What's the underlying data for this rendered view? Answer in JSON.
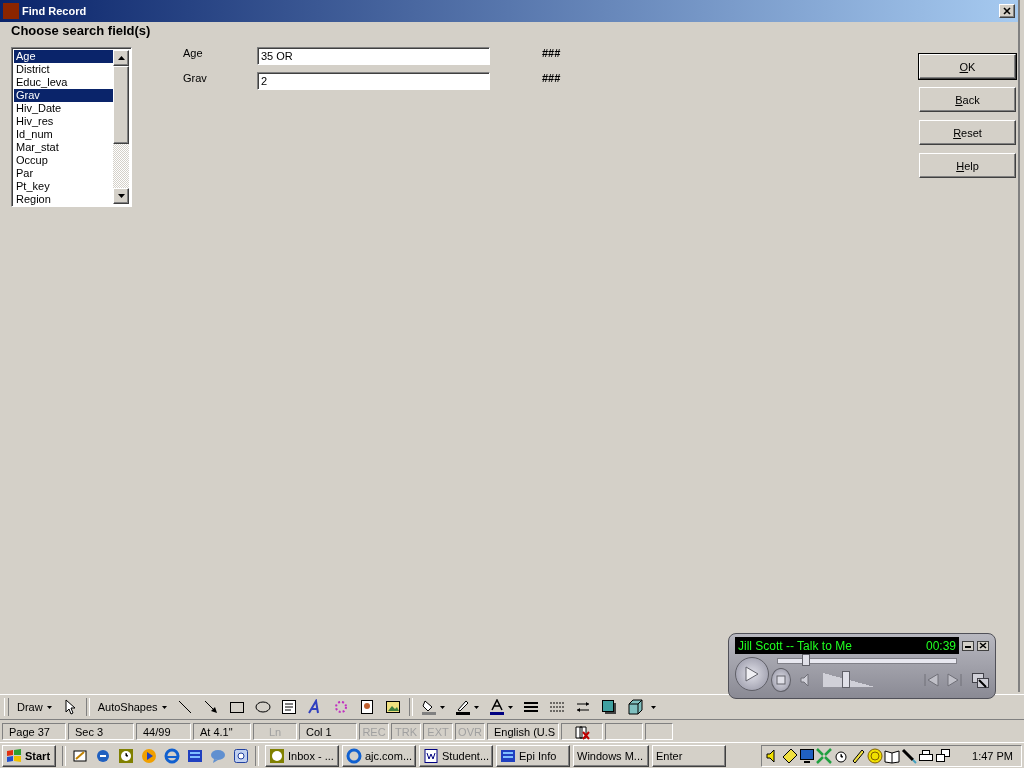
{
  "window": {
    "title": "Find Record",
    "heading": "Choose search field(s)"
  },
  "listbox": {
    "items": [
      {
        "label": "Age",
        "selected": true
      },
      {
        "label": "District",
        "selected": false
      },
      {
        "label": "Educ_leva",
        "selected": false
      },
      {
        "label": "Grav",
        "selected": true
      },
      {
        "label": "Hiv_Date",
        "selected": false
      },
      {
        "label": "Hiv_res",
        "selected": false
      },
      {
        "label": "Id_num",
        "selected": false
      },
      {
        "label": "Mar_stat",
        "selected": false
      },
      {
        "label": "Occup",
        "selected": false
      },
      {
        "label": "Par",
        "selected": false
      },
      {
        "label": "Pt_key",
        "selected": false
      },
      {
        "label": "Region",
        "selected": false
      }
    ]
  },
  "fields": [
    {
      "label": "Age",
      "value": "35 OR",
      "format": "###"
    },
    {
      "label": "Grav",
      "value": "2",
      "format": "###"
    }
  ],
  "buttons": [
    "OK",
    "Back",
    "Reset",
    "Help"
  ],
  "media_player": {
    "track": "Jill Scott -- Talk to Me",
    "time": "00:39",
    "seek": {
      "level": 0.16
    },
    "volume": {
      "level": 0.45
    }
  },
  "drawing_toolbar": {
    "draw_menu": "Draw",
    "autoshapes_menu": "AutoShapes"
  },
  "status_bar": {
    "panes": [
      {
        "text": "Page 37",
        "disabled": false
      },
      {
        "text": "Sec 3",
        "disabled": false
      },
      {
        "text": "44/99",
        "disabled": false
      },
      {
        "text": "At 4.1\"",
        "disabled": false
      },
      {
        "text": "Ln",
        "disabled": true
      },
      {
        "text": "Col 1",
        "disabled": false
      },
      {
        "text": "REC",
        "disabled": true
      },
      {
        "text": "TRK",
        "disabled": true
      },
      {
        "text": "EXT",
        "disabled": true
      },
      {
        "text": "OVR",
        "disabled": true
      },
      {
        "text": "English (U.S",
        "disabled": false
      }
    ]
  },
  "taskbar": {
    "start": "Start",
    "tasks": [
      "Inbox - ...",
      "ajc.com...",
      "Student...",
      "Epi Info",
      "Windows M...",
      "Enter"
    ],
    "clock": "1:47 PM"
  }
}
